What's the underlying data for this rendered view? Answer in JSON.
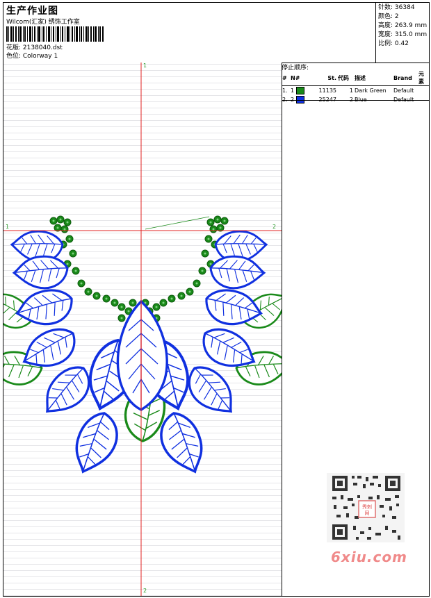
{
  "header": {
    "title": "生产作业图",
    "company": "Wilcom(汇家) 绣饰工作室",
    "design_label": "花版: 2138040.dst",
    "colorway_label": "色位:  Colorway 1"
  },
  "stats": [
    {
      "label": "针数:",
      "value": "36384"
    },
    {
      "label": "颜色:",
      "value": "2"
    },
    {
      "label": "高度:",
      "value": "263.9 mm"
    },
    {
      "label": "宽度:",
      "value": "315.0 mm"
    },
    {
      "label": "比例:",
      "value": "0.42"
    }
  ],
  "stop_sequence": {
    "title": "停止顺序:",
    "columns": [
      "#",
      "N#",
      "St.",
      "代码",
      "描述",
      "Brand",
      "元素"
    ],
    "rows": [
      {
        "idx": "1.",
        "n": "1",
        "color": "#1a8a1a",
        "stitches": "11135",
        "code": "1",
        "desc": "Dark Green",
        "brand": "Default",
        "element": ""
      },
      {
        "idx": "2.",
        "n": "2",
        "color": "#1030e0",
        "stitches": "25247",
        "code": "2",
        "desc": "Blue",
        "brand": "Default",
        "element": ""
      }
    ]
  },
  "axes": {
    "top": "1",
    "bottom": "2",
    "left": "1",
    "right": "2"
  },
  "colors": {
    "green": "#1a8a1a",
    "blue": "#1030e0",
    "crosshair": "#e02020"
  },
  "watermark": "6xiu.com"
}
